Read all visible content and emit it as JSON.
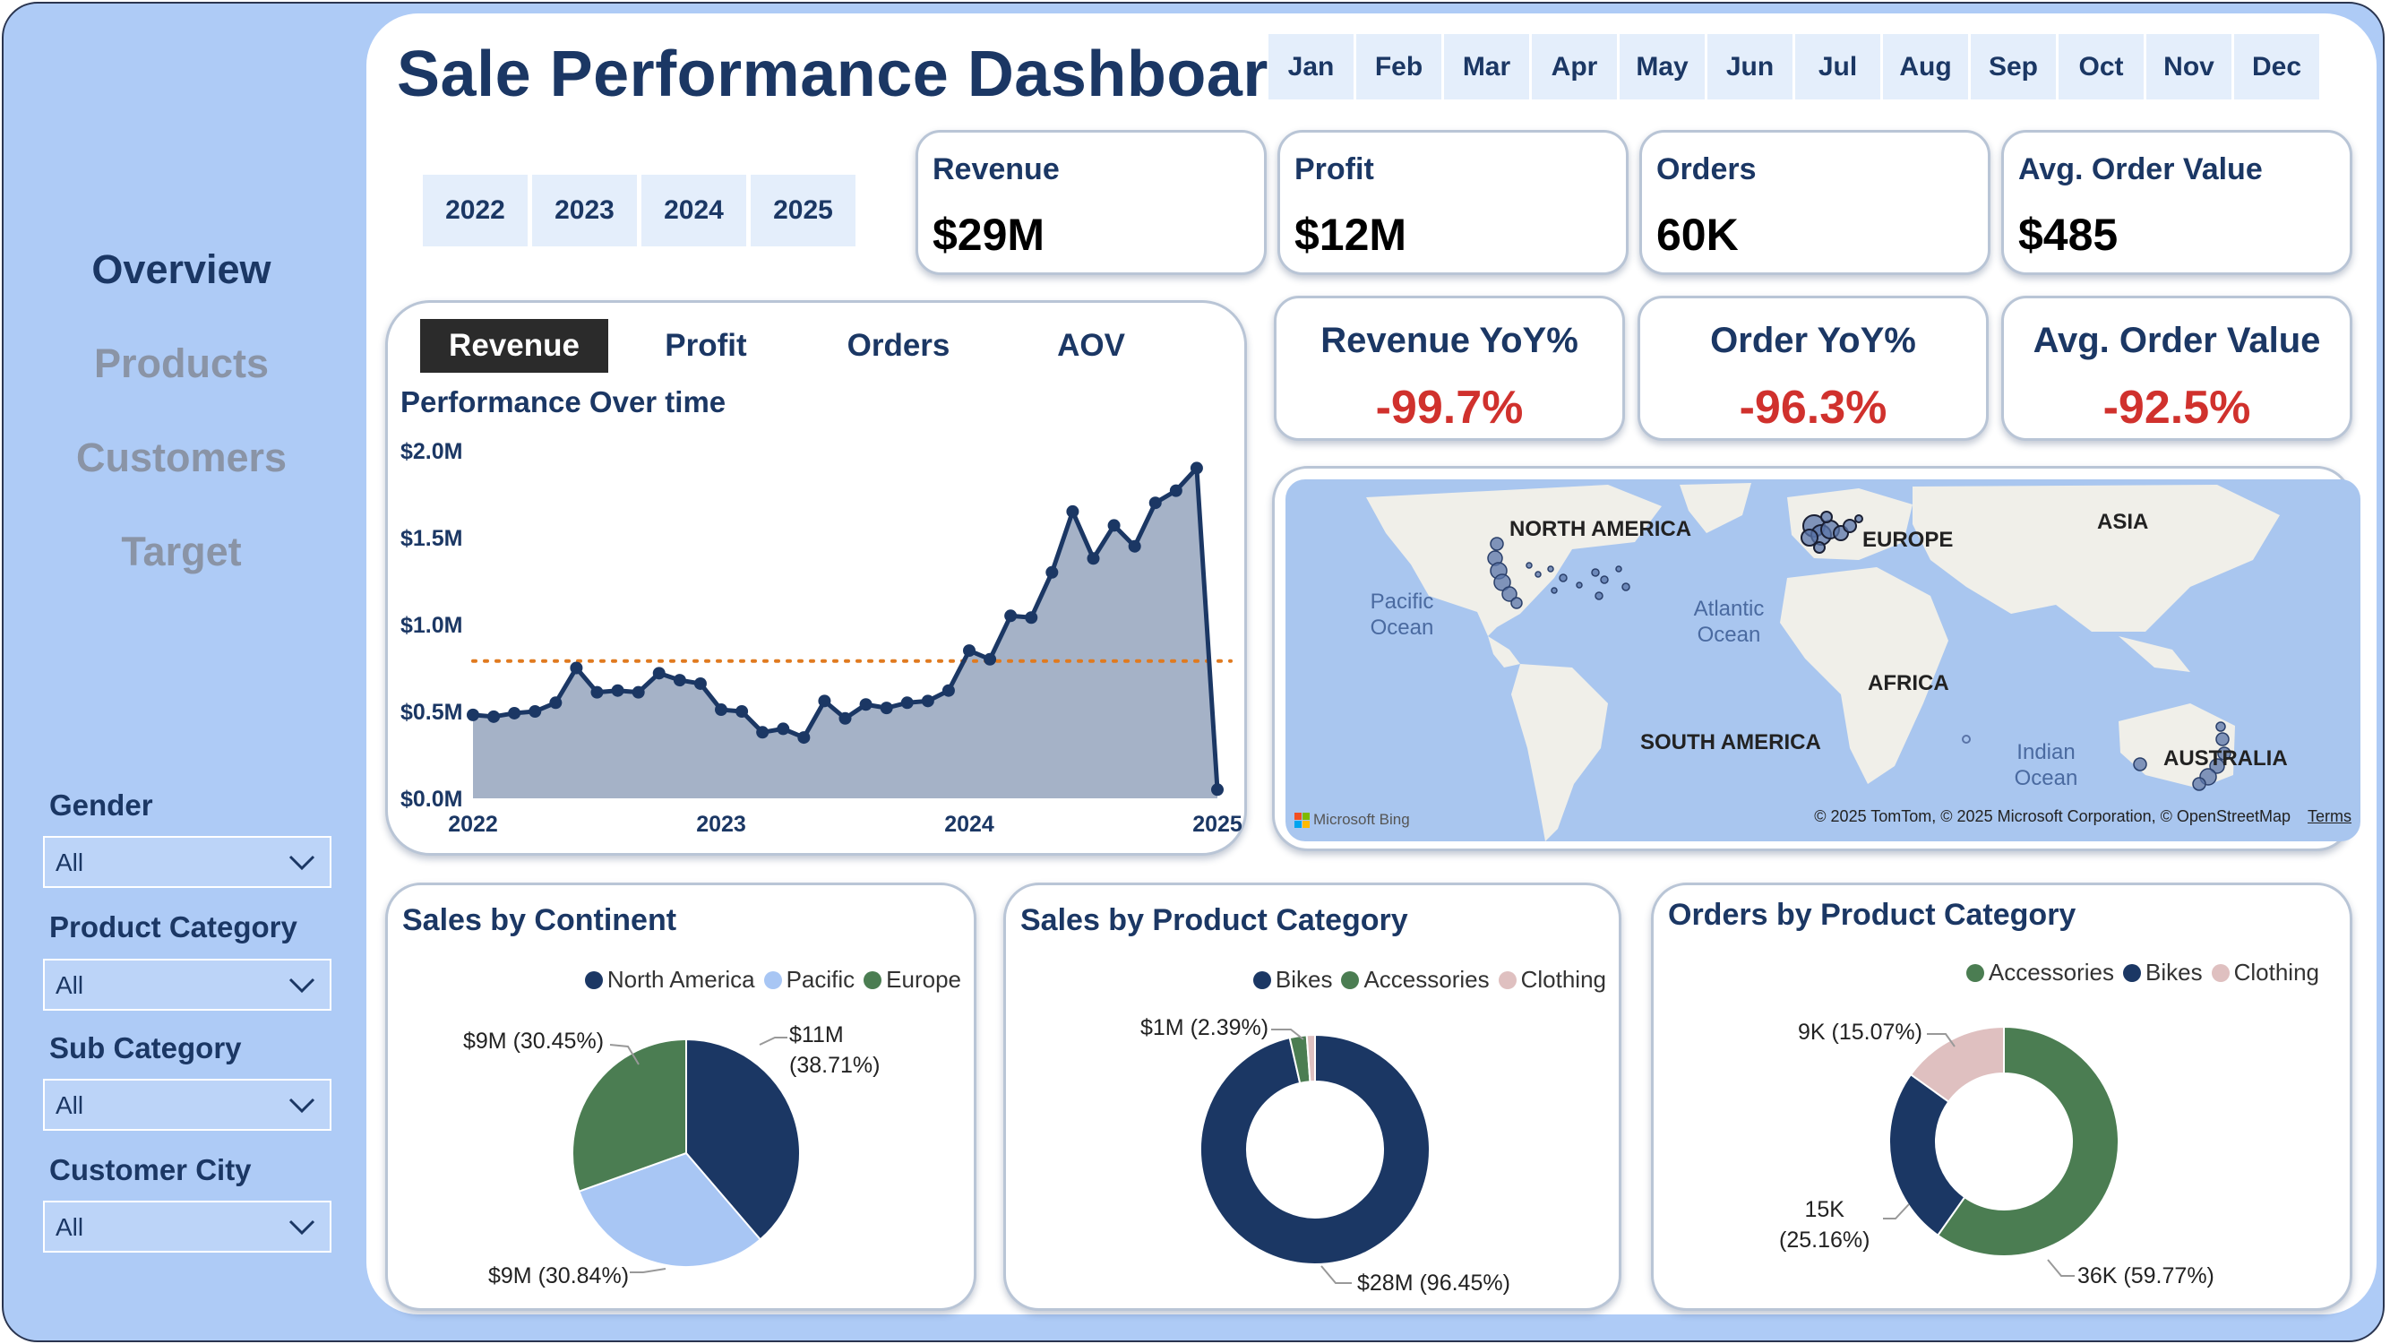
{
  "title": "Sale Performance Dashboard",
  "nav": [
    "Overview",
    "Products",
    "Customers",
    "Target"
  ],
  "filters": [
    {
      "label": "Gender",
      "value": "All"
    },
    {
      "label": "Product Category",
      "value": "All"
    },
    {
      "label": "Sub Category",
      "value": "All"
    },
    {
      "label": "Customer City",
      "value": "All"
    }
  ],
  "months": [
    "Jan",
    "Feb",
    "Mar",
    "Apr",
    "May",
    "Jun",
    "Jul",
    "Aug",
    "Sep",
    "Oct",
    "Nov",
    "Dec"
  ],
  "years": [
    "2022",
    "2023",
    "2024",
    "2025"
  ],
  "kpis": [
    {
      "label": "Revenue",
      "value": "$29M"
    },
    {
      "label": "Profit",
      "value": "$12M"
    },
    {
      "label": "Orders",
      "value": "60K"
    },
    {
      "label": "Avg. Order Value",
      "value": "$485"
    }
  ],
  "yoy": [
    {
      "label": "Revenue YoY%",
      "value": "-99.7%"
    },
    {
      "label": "Order YoY%",
      "value": "-96.3%"
    },
    {
      "label": "Avg. Order Value",
      "value": "-92.5%"
    }
  ],
  "performance": {
    "tabs": [
      "Revenue",
      "Profit",
      "Orders",
      "AOV"
    ],
    "active_tab": "Revenue",
    "title": "Performance Over time"
  },
  "map": {
    "labels": {
      "north_america": "NORTH AMERICA",
      "europe": "EUROPE",
      "asia": "ASIA",
      "africa": "AFRICA",
      "south_america": "SOUTH AMERICA",
      "australia": "AUSTRALIA",
      "pacific_ocean": "Pacific Ocean",
      "atlantic_ocean": "Atlantic Ocean",
      "indian_ocean": "Indian Ocean"
    },
    "brand": "Microsoft Bing",
    "attribution": "© 2025 TomTom, © 2025 Microsoft Corporation, © OpenStreetMap",
    "terms": "Terms",
    "colors": {
      "water": "#a9c6ef",
      "land": "#f0efe9",
      "marker": "#5a74a8"
    }
  },
  "colors": {
    "navy": "#1b3764",
    "light_blue": "#a8c6f4",
    "green": "#4b7d52",
    "pink": "#dfc0c0",
    "area_fill": "#a5b2c7",
    "target_line": "#e07a1f",
    "negative": "#d0312d"
  },
  "chart_data": [
    {
      "type": "area",
      "title": "Performance Over time",
      "ylabel": "Revenue",
      "x_ticks": [
        "2022",
        "2023",
        "2024",
        "2025"
      ],
      "y_ticks": [
        "$0.0M",
        "$0.5M",
        "$1.0M",
        "$1.5M",
        "$2.0M"
      ],
      "ylim": [
        0,
        2.0
      ],
      "unit": "$M",
      "series": [
        {
          "values": [
            0.48,
            0.47,
            0.49,
            0.5,
            0.55,
            0.75,
            0.61,
            0.62,
            0.61,
            0.72,
            0.68,
            0.66,
            0.51,
            0.5,
            0.38,
            0.4,
            0.35,
            0.56,
            0.46,
            0.54,
            0.52,
            0.55,
            0.56,
            0.62,
            0.85,
            0.8,
            1.05,
            1.04,
            1.3,
            1.65,
            1.38,
            1.57,
            1.45,
            1.7,
            1.77,
            1.9,
            0.05
          ]
        }
      ],
      "target_line": 0.79,
      "grid": false
    },
    {
      "type": "pie",
      "title": "Sales by Continent",
      "legend": [
        "North America",
        "Pacific",
        "Europe"
      ],
      "legend_position": "top-right",
      "slices": [
        {
          "name": "North America",
          "value": 38.71,
          "label": "$11M\n(38.71%)",
          "color": "#1b3764"
        },
        {
          "name": "Pacific",
          "value": 30.84,
          "label": "$9M (30.84%)",
          "color": "#a8c6f4"
        },
        {
          "name": "Europe",
          "value": 30.45,
          "label": "$9M (30.45%)",
          "color": "#4b7d52"
        }
      ]
    },
    {
      "type": "pie",
      "donut": true,
      "title": "Sales by Product Category",
      "legend": [
        "Bikes",
        "Accessories",
        "Clothing"
      ],
      "legend_position": "top-right",
      "slices": [
        {
          "name": "Bikes",
          "value": 96.45,
          "label": "$28M (96.45%)",
          "color": "#1b3764"
        },
        {
          "name": "Accessories",
          "value": 2.39,
          "label": "$1M (2.39%)",
          "color": "#4b7d52"
        },
        {
          "name": "Clothing",
          "value": 1.16,
          "label": "",
          "color": "#dfc0c0"
        }
      ]
    },
    {
      "type": "pie",
      "donut": true,
      "title": "Orders by Product Category",
      "legend": [
        "Accessories",
        "Bikes",
        "Clothing"
      ],
      "legend_position": "top-right",
      "slices": [
        {
          "name": "Accessories",
          "value": 59.77,
          "label": "36K (59.77%)",
          "color": "#4b7d52"
        },
        {
          "name": "Bikes",
          "value": 25.16,
          "label": "15K\n(25.16%)",
          "color": "#1b3764"
        },
        {
          "name": "Clothing",
          "value": 15.07,
          "label": "9K (15.07%)",
          "color": "#dfc0c0"
        }
      ]
    }
  ]
}
